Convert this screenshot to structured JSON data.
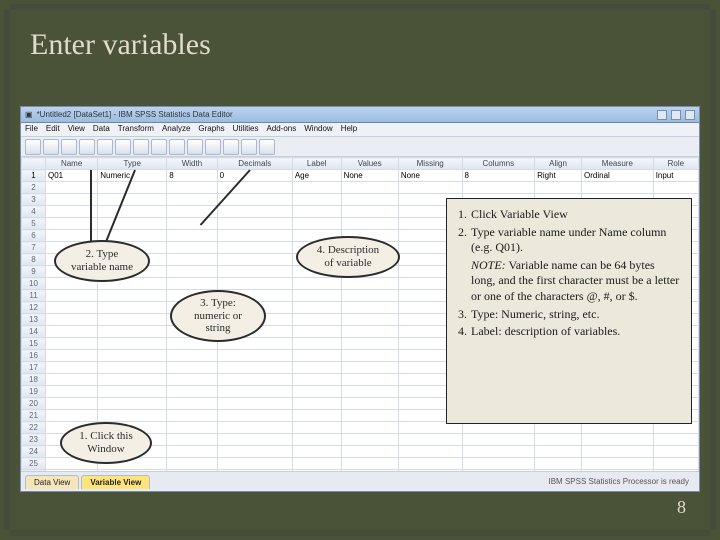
{
  "slide": {
    "title": "Enter variables",
    "page_number": "8"
  },
  "spss": {
    "window_title": "*Untitled2 [DataSet1] - IBM SPSS Statistics Data Editor",
    "menus": [
      "File",
      "Edit",
      "View",
      "Data",
      "Transform",
      "Analyze",
      "Graphs",
      "Utilities",
      "Add-ons",
      "Window",
      "Help"
    ],
    "columns": [
      "Name",
      "Type",
      "Width",
      "Decimals",
      "Label",
      "Values",
      "Missing",
      "Columns",
      "Align",
      "Measure",
      "Role"
    ],
    "row": {
      "num": "1",
      "name": "Q01",
      "type": "Numeric",
      "width": "8",
      "decimals": "0",
      "label": "Age",
      "values": "None",
      "missing": "None",
      "columns_w": "8",
      "align": "Right",
      "measure": "Ordinal",
      "role": "Input"
    },
    "tabs": {
      "data_view": "Data View",
      "variable_view": "Variable View"
    },
    "status": "IBM SPSS Statistics Processor is ready"
  },
  "callouts": {
    "c1": {
      "text1": "1. Click this",
      "text2": "Window"
    },
    "c2": {
      "text1": "2. Type",
      "text2": "variable name"
    },
    "c3": {
      "text1": "3. Type:",
      "text2": "numeric or",
      "text3": "string"
    },
    "c4": {
      "text1": "4. Description",
      "text2": "of variable"
    }
  },
  "instructions": {
    "i1": {
      "num": "1.",
      "text": "Click Variable View"
    },
    "i2": {
      "num": "2.",
      "text": "Type variable name under Name column (e.g. Q01)."
    },
    "note_label": "NOTE:",
    "note_text": " Variable name can be 64 bytes long, and the first character must be a letter or one of the characters @, #, or $.",
    "i3": {
      "num": "3.",
      "text": "Type: Numeric, string, etc."
    },
    "i4": {
      "num": "4.",
      "text": "Label: description of variables."
    }
  }
}
